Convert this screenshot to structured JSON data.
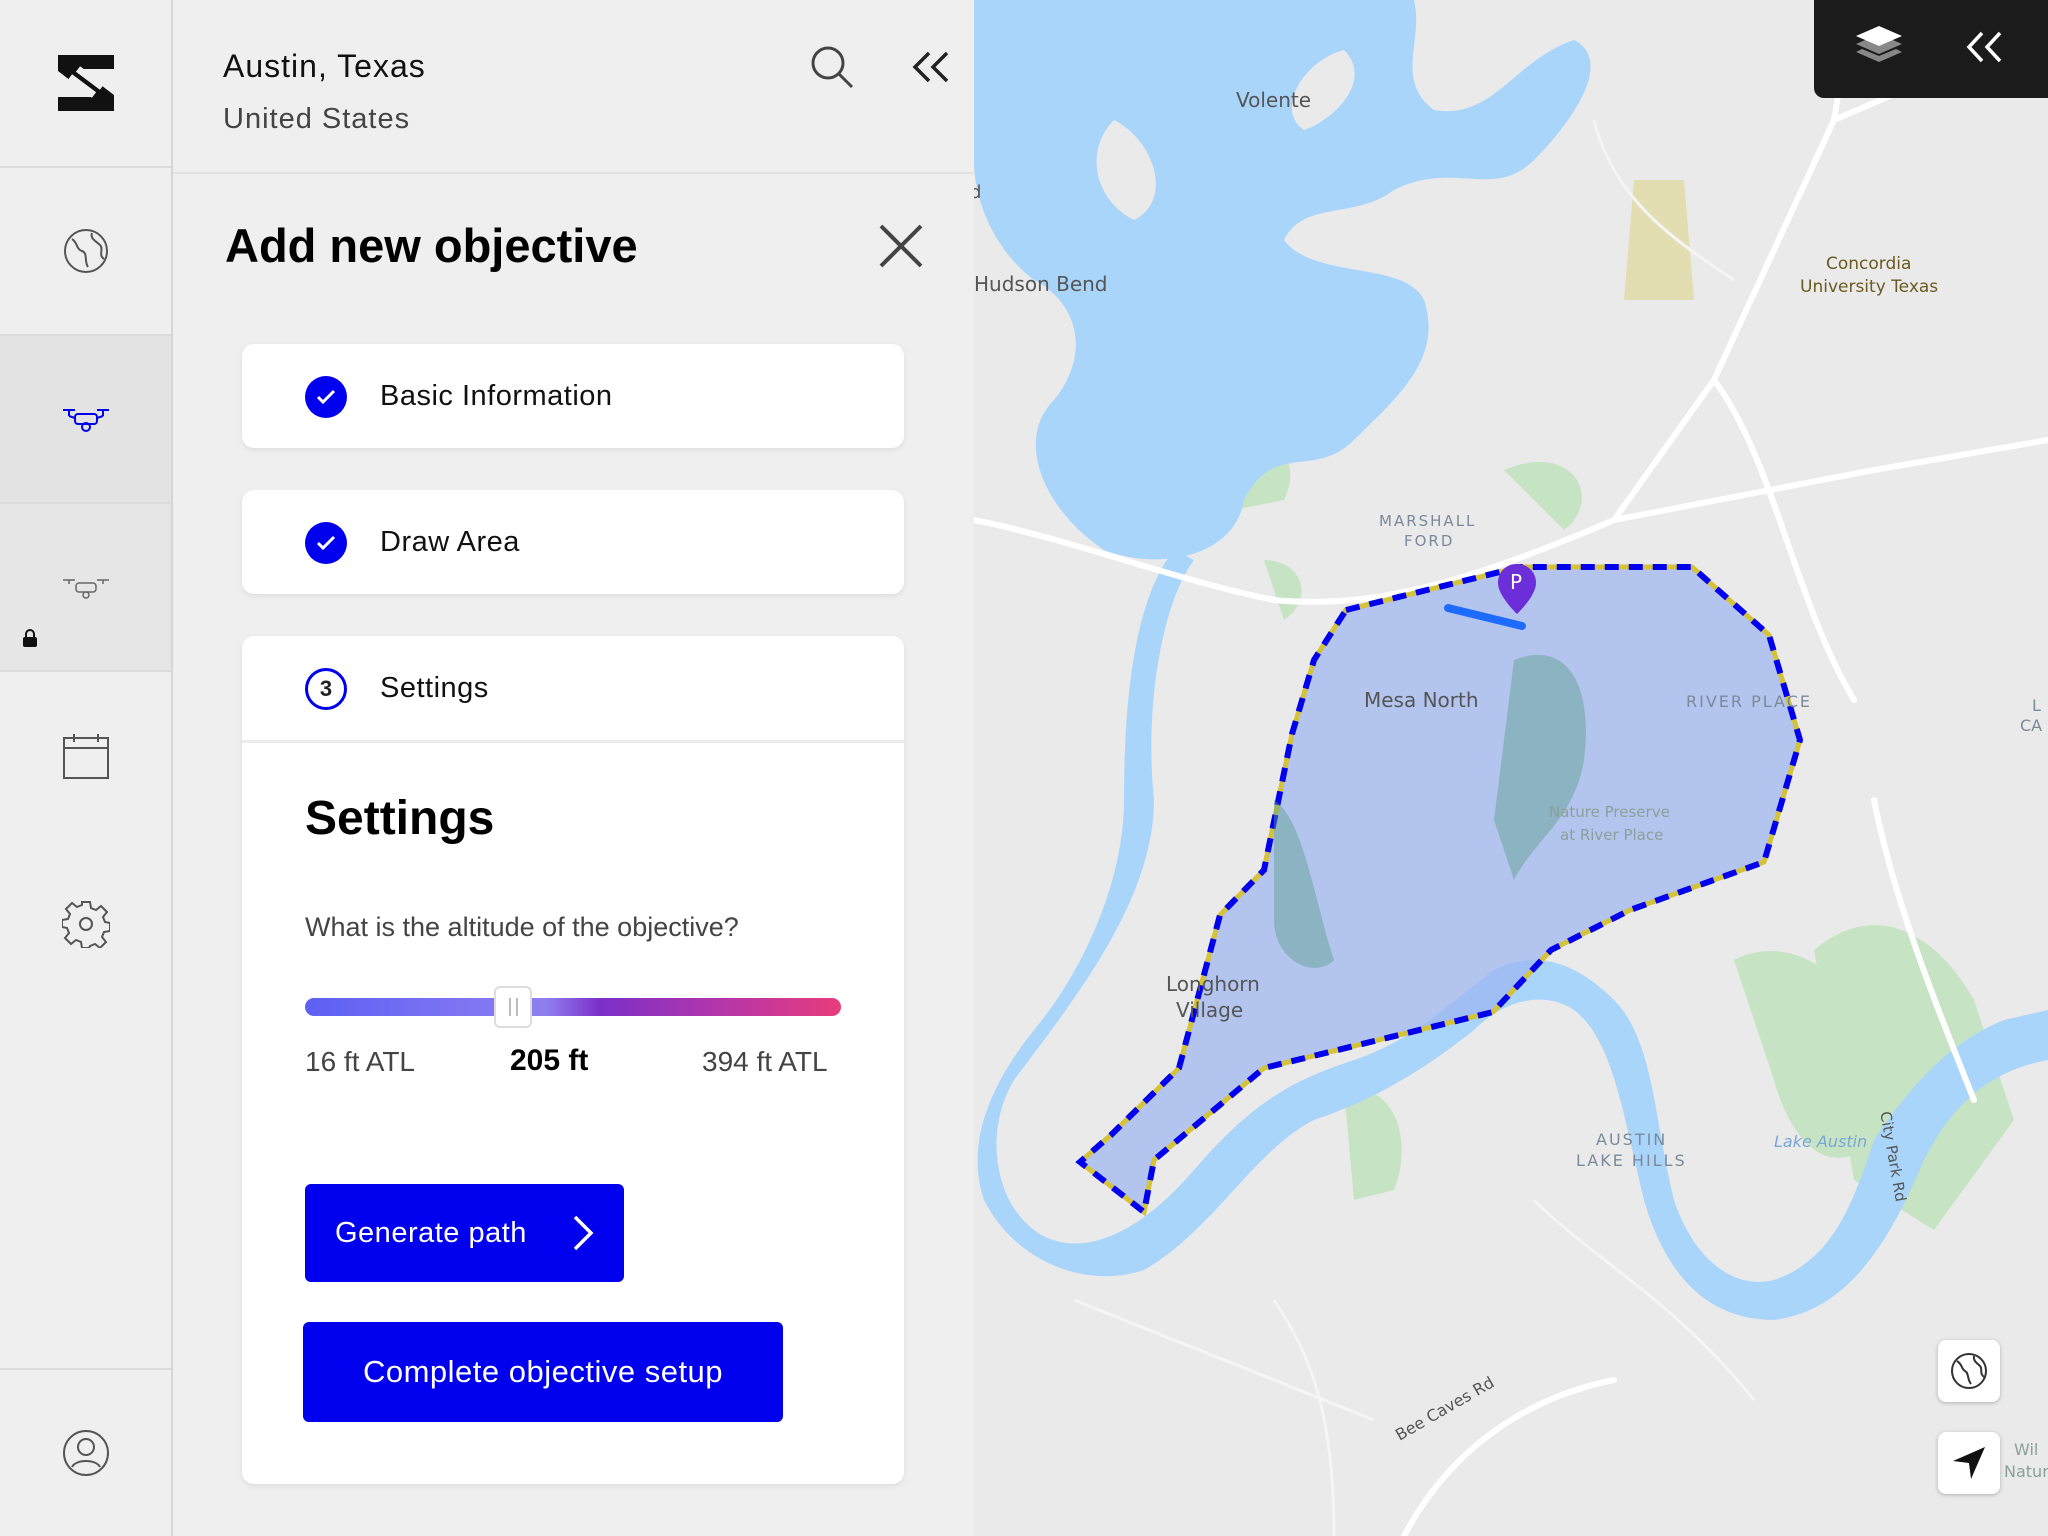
{
  "location": {
    "city": "Austin, Texas",
    "country": "United States"
  },
  "panel": {
    "title": "Add new objective",
    "steps": [
      {
        "label": "Basic Information",
        "state": "done"
      },
      {
        "label": "Draw Area",
        "state": "done"
      },
      {
        "label": "Settings",
        "state": "current",
        "number": "3"
      }
    ]
  },
  "settings": {
    "heading": "Settings",
    "question": "What is the altitude of the objective?",
    "slider": {
      "min_label": "16 ft ATL",
      "value_label": "205 ft",
      "max_label": "394 ft ATL",
      "min": 16,
      "max": 394,
      "value": 205
    },
    "generate_label": "Generate path",
    "complete_label": "Complete objective setup"
  },
  "map": {
    "labels": {
      "volente": "Volente",
      "hudson_bend": "Hudson Bend",
      "concordia_1": "Concordia",
      "concordia_2": "University Texas",
      "marshall_1": "MARSHALL",
      "marshall_2": "FORD",
      "mesa_north": "Mesa North",
      "river_place": "RIVER PLACE",
      "nature_1": "Nature Preserve",
      "nature_2": "at River Place",
      "longhorn_1": "Longhorn",
      "longhorn_2": "Village",
      "austin_lake_1": "AUSTIN",
      "austin_lake_2": "LAKE HILLS",
      "lake_austin": "Lake Austin",
      "city_park": "City Park Rd",
      "bee_caves": "Bee Caves Rd",
      "edge_l": "L",
      "edge_ca": "CA",
      "edge_wil": "Wil",
      "edge_nature": "Nature",
      "edge_d": "d",
      "pin_letter": "P"
    }
  },
  "colors": {
    "accent": "#0000ee",
    "water": "#aad5fb",
    "park": "#c6e4c4",
    "objective_fill": "#9bb4f0",
    "pin": "#6b2ed8"
  },
  "icons": {
    "logo": "logo-icon",
    "globe": "globe-icon",
    "drone": "drone-icon",
    "drone_locked": "drone-locked-icon",
    "calendar": "calendar-icon",
    "settings": "gear-icon",
    "profile": "user-icon",
    "search": "search-icon",
    "collapse": "double-chevron-left-icon",
    "close": "close-icon",
    "layers": "layers-icon",
    "locate": "navigation-arrow-icon"
  }
}
